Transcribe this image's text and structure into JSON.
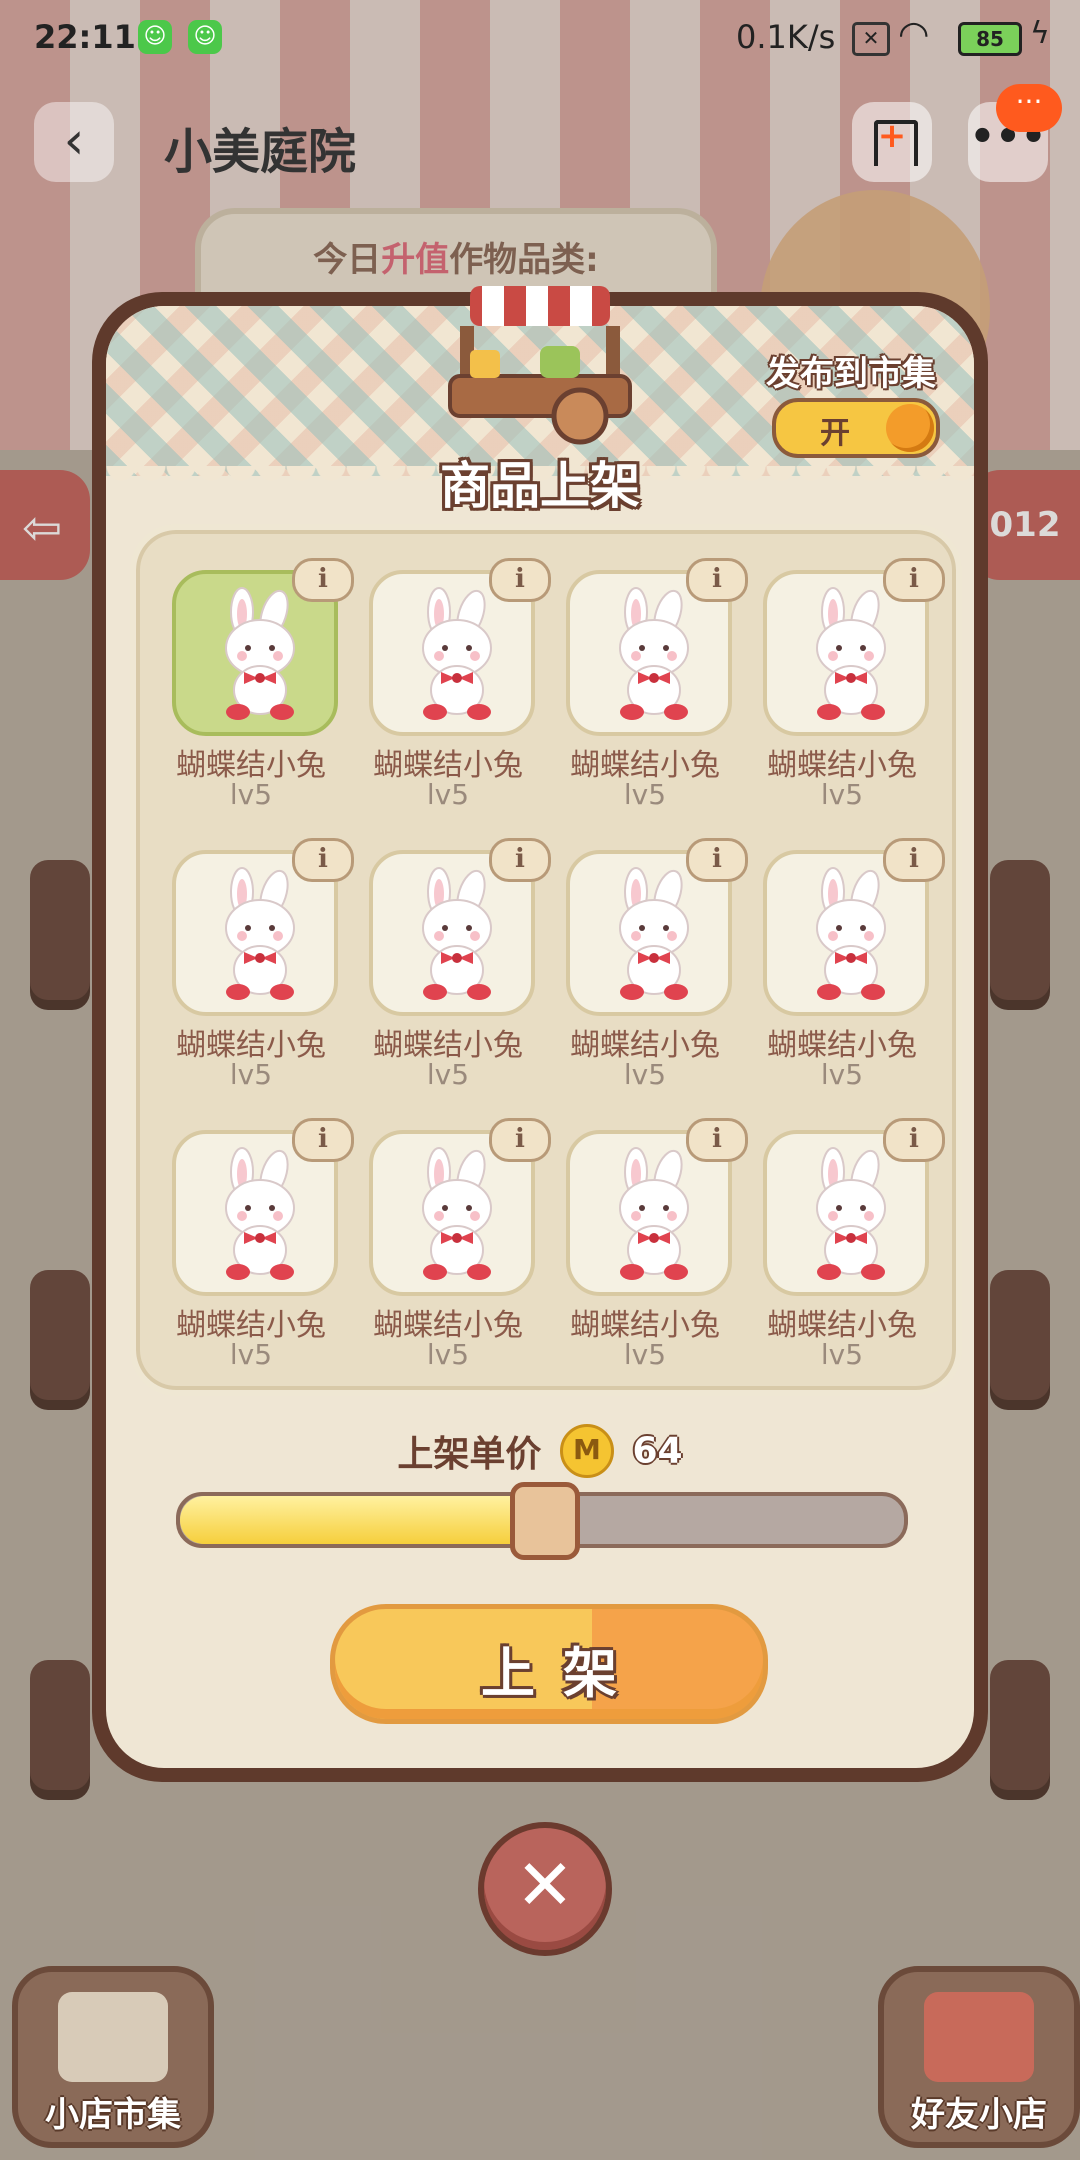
{
  "status_bar": {
    "time": "22:11",
    "net_speed": "0.1K/s",
    "battery": "85"
  },
  "header": {
    "back_icon": "chevron-left-icon",
    "title": "小美庭院",
    "more_label": "•••",
    "notification_label": "···"
  },
  "background": {
    "banner_prefix": "今日",
    "banner_highlight": "升值",
    "banner_suffix": "作物品类:",
    "side_number": "012",
    "corner_left_label": "小店市集",
    "corner_right_label": "好友小店"
  },
  "modal": {
    "title": "商品上架",
    "publish_label": "发布到市集",
    "toggle_label": "开",
    "toggle_on": true,
    "items": [
      {
        "name": "蝴蝶结小兔",
        "level": "lv5",
        "info": "i",
        "selected": true
      },
      {
        "name": "蝴蝶结小兔",
        "level": "lv5",
        "info": "i",
        "selected": false
      },
      {
        "name": "蝴蝶结小兔",
        "level": "lv5",
        "info": "i",
        "selected": false
      },
      {
        "name": "蝴蝶结小兔",
        "level": "lv5",
        "info": "i",
        "selected": false
      },
      {
        "name": "蝴蝶结小兔",
        "level": "lv5",
        "info": "i",
        "selected": false
      },
      {
        "name": "蝴蝶结小兔",
        "level": "lv5",
        "info": "i",
        "selected": false
      },
      {
        "name": "蝴蝶结小兔",
        "level": "lv5",
        "info": "i",
        "selected": false
      },
      {
        "name": "蝴蝶结小兔",
        "level": "lv5",
        "info": "i",
        "selected": false
      },
      {
        "name": "蝴蝶结小兔",
        "level": "lv5",
        "info": "i",
        "selected": false
      },
      {
        "name": "蝴蝶结小兔",
        "level": "lv5",
        "info": "i",
        "selected": false
      },
      {
        "name": "蝴蝶结小兔",
        "level": "lv5",
        "info": "i",
        "selected": false
      },
      {
        "name": "蝴蝶结小兔",
        "level": "lv5",
        "info": "i",
        "selected": false
      }
    ],
    "price_label": "上架单价",
    "coin_symbol": "M",
    "price_value": "64",
    "slider_fraction": 0.5,
    "list_button_label": "上架",
    "close_label": "✕"
  },
  "colors": {
    "accent": "#f6c642",
    "frame": "#5f3a2c",
    "highlight": "#e26d7e"
  }
}
